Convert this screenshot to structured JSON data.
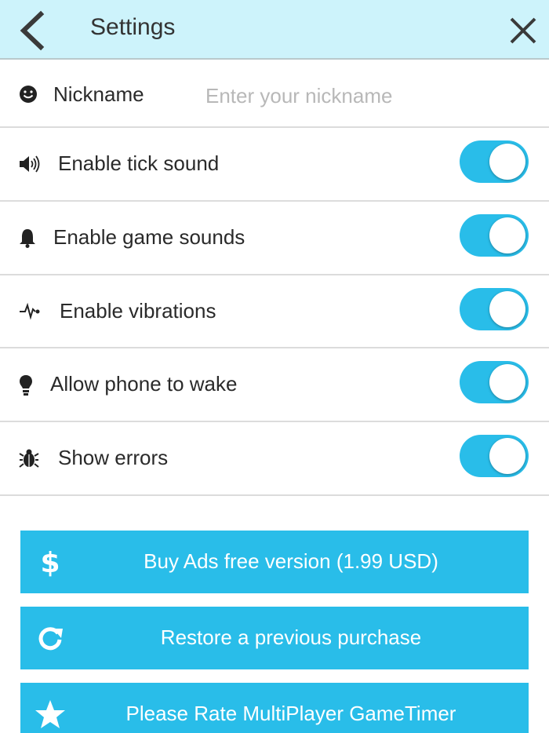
{
  "header": {
    "title": "Settings",
    "background": "#cdf3fb"
  },
  "nickname": {
    "label": "Nickname",
    "value": "",
    "placeholder": "Enter your nickname",
    "icon": "smiley-icon"
  },
  "settings": [
    {
      "label": "Enable tick sound",
      "icon": "speaker-icon",
      "enabled": true
    },
    {
      "label": "Enable game sounds",
      "icon": "bell-icon",
      "enabled": true
    },
    {
      "label": "Enable vibrations",
      "icon": "pulse-icon",
      "enabled": true
    },
    {
      "label": "Allow phone to wake",
      "icon": "lightbulb-icon",
      "enabled": true
    },
    {
      "label": "Show errors",
      "icon": "bug-icon",
      "enabled": true
    }
  ],
  "actions": [
    {
      "label": "Buy Ads free version (1.99 USD)",
      "icon": "dollar-icon"
    },
    {
      "label": "Restore a previous purchase",
      "icon": "refresh-icon"
    },
    {
      "label": "Please Rate MultiPlayer GameTimer",
      "icon": "star-icon"
    }
  ],
  "colors": {
    "accent": "#29bde9",
    "divider": "#dcdcdc"
  }
}
